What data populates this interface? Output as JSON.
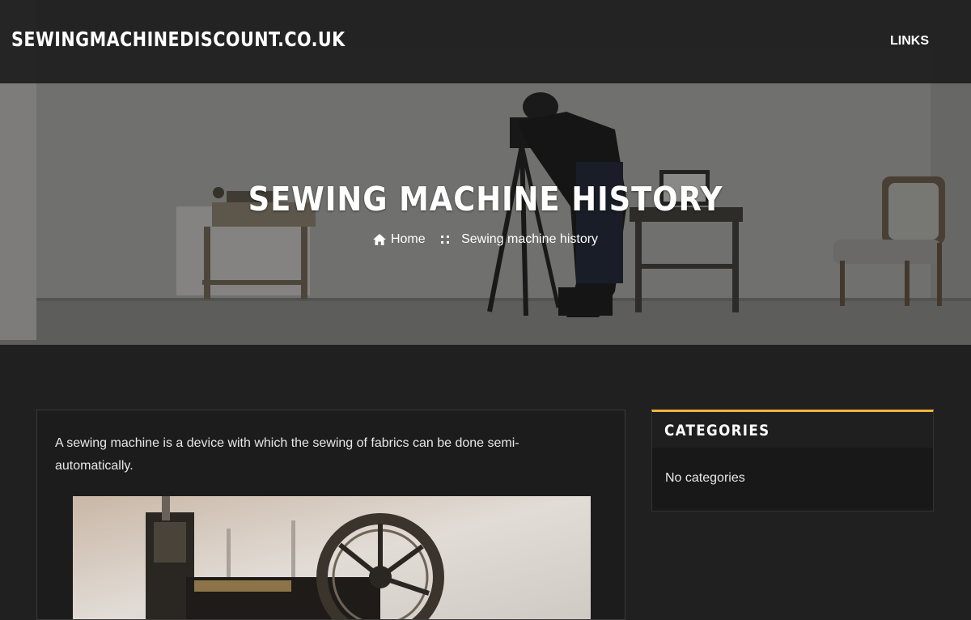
{
  "header": {
    "site_title": "SEWINGMACHINEDISCOUNT.CO.UK",
    "nav": [
      {
        "label": "LINKS"
      }
    ]
  },
  "hero": {
    "title": "SEWING MACHINE HISTORY",
    "breadcrumb": {
      "home_icon": "home-icon",
      "home": "Home",
      "separator_icon": "four-dots-separator-icon",
      "current": "Sewing machine history"
    }
  },
  "article": {
    "intro": "A sewing machine is a device with which the sewing of fabrics can be done semi-automatically."
  },
  "sidebar": {
    "categories": {
      "title": "CATEGORIES",
      "empty_text": "No categories",
      "accent_color": "#f2b43b"
    }
  }
}
